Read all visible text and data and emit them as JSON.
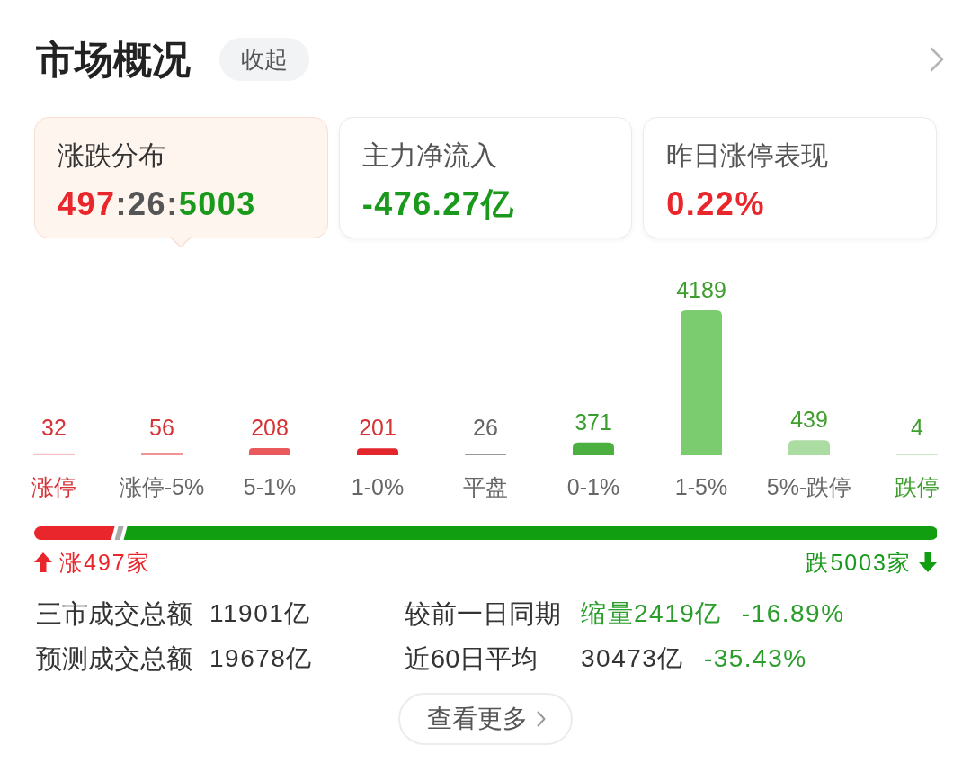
{
  "header": {
    "title": "市场概况",
    "collapse_button": "收起"
  },
  "cards": [
    {
      "label": "涨跌分布",
      "selected": true,
      "value_parts": [
        {
          "text": "497",
          "color": "#e8262b"
        },
        {
          "text": ":",
          "color": "#555555"
        },
        {
          "text": "26",
          "color": "#555555"
        },
        {
          "text": ":",
          "color": "#555555"
        },
        {
          "text": "5003",
          "color": "#1a9a1c"
        }
      ]
    },
    {
      "label": "主力净流入",
      "selected": false,
      "value_parts": [
        {
          "text": "-476.27亿",
          "color": "#1a9a1c"
        }
      ]
    },
    {
      "label": "昨日涨停表现",
      "selected": false,
      "value_parts": [
        {
          "text": "0.22%",
          "color": "#e8262b"
        }
      ]
    }
  ],
  "distribution": {
    "chart_data": {
      "type": "bar",
      "categories": [
        "涨停",
        "涨停-5%",
        "5-1%",
        "1-0%",
        "平盘",
        "0-1%",
        "1-5%",
        "5%-跌停",
        "跌停"
      ],
      "series": [
        {
          "values": [
            32,
            56,
            208,
            201,
            26,
            371,
            4189,
            439,
            4
          ],
          "colors": [
            "#f7c2c4",
            "#f09496",
            "#ea5a5c",
            "#e2262c",
            "#999999",
            "#4cb041",
            "#7bcb6f",
            "#abdca1",
            "#cdebc8"
          ]
        }
      ],
      "data_labels": true
    },
    "category_highlight": [
      true,
      false,
      false,
      false,
      false,
      false,
      false,
      false,
      true
    ]
  },
  "breadth": {
    "segments": [
      {
        "kind": "up",
        "level": 0.0899
      },
      {
        "kind": "flat",
        "level": 0.0047
      },
      {
        "kind": "down",
        "level": 0.9054
      }
    ],
    "up_label": "涨497家",
    "down_label": "跌5003家"
  },
  "stats": [
    {
      "label": "三市成交总额",
      "parts": [
        {
          "text": "11901亿",
          "color": "#333333"
        }
      ]
    },
    {
      "label": "较前一日同期",
      "parts": [
        {
          "text": "缩量2419亿",
          "color": "#2a9d2a"
        },
        {
          "text": "-16.89%",
          "color": "#2a9d2a"
        }
      ]
    },
    {
      "label": "预测成交总额",
      "parts": [
        {
          "text": "19678亿",
          "color": "#333333"
        }
      ]
    },
    {
      "label": "近60日平均",
      "parts": [
        {
          "text": "30473亿",
          "color": "#333333"
        },
        {
          "text": "-35.43%",
          "color": "#2a9d2a"
        }
      ]
    }
  ],
  "more_button": "查看更多"
}
